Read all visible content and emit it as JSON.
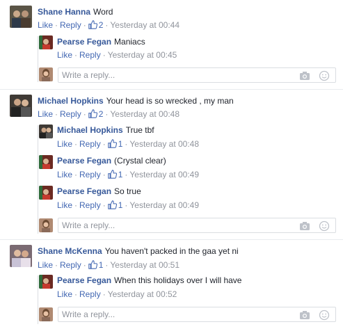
{
  "actions": {
    "like": "Like",
    "reply": "Reply",
    "dot": "·"
  },
  "reply_placeholder": "Write a reply...",
  "threads": [
    {
      "comment": {
        "author": "Shane Hanna",
        "text": "Word",
        "likes": "2",
        "time": "Yesterday at 00:44"
      },
      "replies": [
        {
          "author": "Pearse Fegan",
          "text": "Maniacs",
          "likes": "",
          "time": "Yesterday at 00:45"
        }
      ]
    },
    {
      "comment": {
        "author": "Michael Hopkins",
        "text": "Your head is so wrecked , my man",
        "likes": "2",
        "time": "Yesterday at 00:48"
      },
      "replies": [
        {
          "author": "Michael Hopkins",
          "text": "True tbf",
          "likes": "1",
          "time": "Yesterday at 00:48"
        },
        {
          "author": "Pearse Fegan",
          "text": "(Crystal clear)",
          "likes": "1",
          "time": "Yesterday at 00:49"
        },
        {
          "author": "Pearse Fegan",
          "text": "So true",
          "likes": "1",
          "time": "Yesterday at 00:49"
        }
      ]
    },
    {
      "comment": {
        "author": "Shane McKenna",
        "text": "You haven't packed in the gaa yet ni",
        "likes": "1",
        "time": "Yesterday at 00:51"
      },
      "replies": [
        {
          "author": "Pearse Fegan",
          "text": "When this holidays over I will have",
          "likes": "",
          "time": "Yesterday at 00:52"
        }
      ]
    }
  ]
}
